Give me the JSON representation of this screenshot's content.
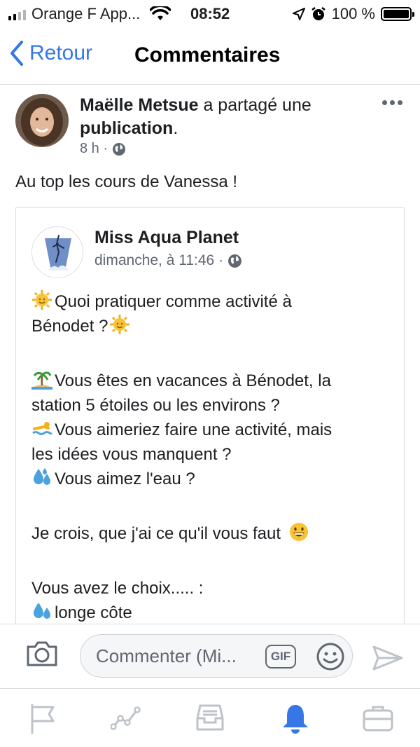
{
  "status_bar": {
    "carrier": "Orange F App...",
    "time": "08:52",
    "battery": "100 %"
  },
  "nav": {
    "back_label": "Retour",
    "title": "Commentaires"
  },
  "post": {
    "author": "Maëlle Metsue",
    "action": " a partagé une ",
    "object": "publication",
    "object_suffix": ".",
    "time": "8 h ·",
    "text": "Au top les cours de Vanessa !"
  },
  "shared_post": {
    "page_name": "Miss Aqua Planet",
    "time": "dimanche, à 11:46 ·",
    "lines": {
      "l1": "Quoi pratiquer comme activité à",
      "l2": "Bénodet ?",
      "l3": "Vous êtes en vacances à Bénodet, la",
      "l4": "station 5 étoiles ou les environs ?",
      "l5": "Vous aimeriez faire une activité, mais",
      "l6": "les idées vous manquent ?",
      "l7": "Vous aimez l'eau ?",
      "l8": "Je crois, que j'ai ce qu'il vous faut",
      "l9": "Vous avez le choix..... :",
      "l10": "longe côte"
    }
  },
  "composer": {
    "placeholder": "Commenter (Mi...",
    "gif_label": "GIF"
  },
  "tabs": [
    "pages-flag-icon",
    "activity-chart-icon",
    "inbox-icon",
    "notifications-bell-icon",
    "tools-briefcase-icon"
  ],
  "colors": {
    "accent": "#3578e5",
    "secondary_text": "#606770",
    "border": "#dcdde1"
  }
}
